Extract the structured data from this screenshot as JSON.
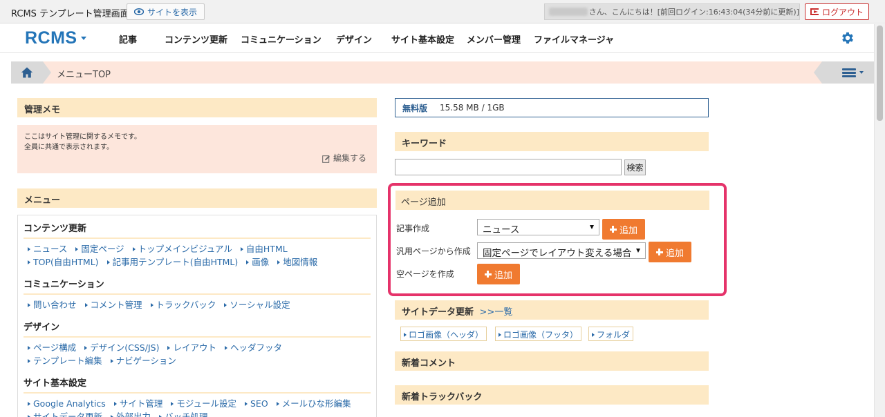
{
  "topbar": {
    "app_title": "RCMS テンプレート管理画面",
    "view_site": "サイトを表示",
    "greeting": "さん、こんにちは！[前回ログイン:16:43:04(34分前に更新)]",
    "logout": "ログアウト"
  },
  "nav": {
    "brand": "RCMS",
    "items": [
      "記事",
      "コンテンツ更新",
      "コミュニケーション",
      "デザイン",
      "サイト基本設定",
      "メンバー管理",
      "ファイルマネージャ"
    ]
  },
  "breadcrumb": {
    "current": "メニューTOP"
  },
  "memo": {
    "title": "管理メモ",
    "line1": "ここはサイト管理に関するメモです。",
    "line2": "全員に共通で表示されます。",
    "edit": "編集する"
  },
  "menu": {
    "title": "メニュー",
    "sections": [
      {
        "title": "コンテンツ更新",
        "links": [
          "ニュース",
          "固定ページ",
          "トップメインビジュアル",
          "自由HTML",
          "TOP(自由HTML)",
          "記事用テンプレート(自由HTML)",
          "画像",
          "地図情報"
        ]
      },
      {
        "title": "コミュニケーション",
        "links": [
          "問い合わせ",
          "コメント管理",
          "トラックバック",
          "ソーシャル設定"
        ]
      },
      {
        "title": "デザイン",
        "links": [
          "ページ構成",
          "デザイン(CSS/JS)",
          "レイアウト",
          "ヘッダフッタ",
          "テンプレート編集",
          "ナビゲーション"
        ]
      },
      {
        "title": "サイト基本設定",
        "links": [
          "Google Analytics",
          "サイト管理",
          "モジュール設定",
          "SEO",
          "メールひな形編集",
          "サイトデータ更新",
          "外部出力",
          "バッチ処理"
        ]
      }
    ]
  },
  "storage": {
    "plan": "無料版",
    "usage": "15.58 MB / 1GB"
  },
  "keyword": {
    "title": "キーワード",
    "search": "検索",
    "value": ""
  },
  "page_add": {
    "title": "ページ追加",
    "rows": [
      {
        "label": "記事作成",
        "select": "ニュース",
        "button": "追加"
      },
      {
        "label": "汎用ページから作成",
        "select": "固定ページでレイアウト変える場合",
        "button": "追加"
      },
      {
        "label": "空ページを作成",
        "button": "追加"
      }
    ]
  },
  "site_data": {
    "title": "サイトデータ更新",
    "list_link": ">>一覧",
    "items": [
      "ロゴ画像（ヘッダ）",
      "ロゴ画像（フッタ）",
      "フォルダ"
    ]
  },
  "new_comments": {
    "title": "新着コメント"
  },
  "new_trackbacks": {
    "title": "新着トラックバック"
  },
  "colors": {
    "accent": "#2475b8",
    "orange": "#f07a30",
    "highlight": "#e5336a",
    "header_bg": "#fde9c5",
    "memo_bg": "#fde6dc"
  },
  "icons": {
    "eye": "eye-icon",
    "logout": "logout-icon",
    "gear": "gear-icon",
    "home": "home-icon",
    "menu": "hamburger-icon",
    "pencil": "pencil-icon",
    "plus": "plus-icon"
  }
}
